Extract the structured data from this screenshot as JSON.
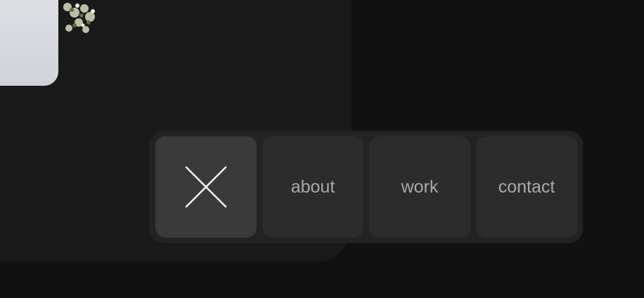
{
  "background": {
    "page_color": "#111111",
    "card_color": "#191919"
  },
  "nav": {
    "close_icon": "close-icon",
    "items": [
      {
        "label": "about"
      },
      {
        "label": "work"
      },
      {
        "label": "contact"
      }
    ]
  },
  "colors": {
    "bar": "#232323",
    "button": "#2c2c2c",
    "button_active": "#3a3a3a",
    "label_text": "#a9a9a9",
    "icon_stroke": "#f2f2f2"
  }
}
